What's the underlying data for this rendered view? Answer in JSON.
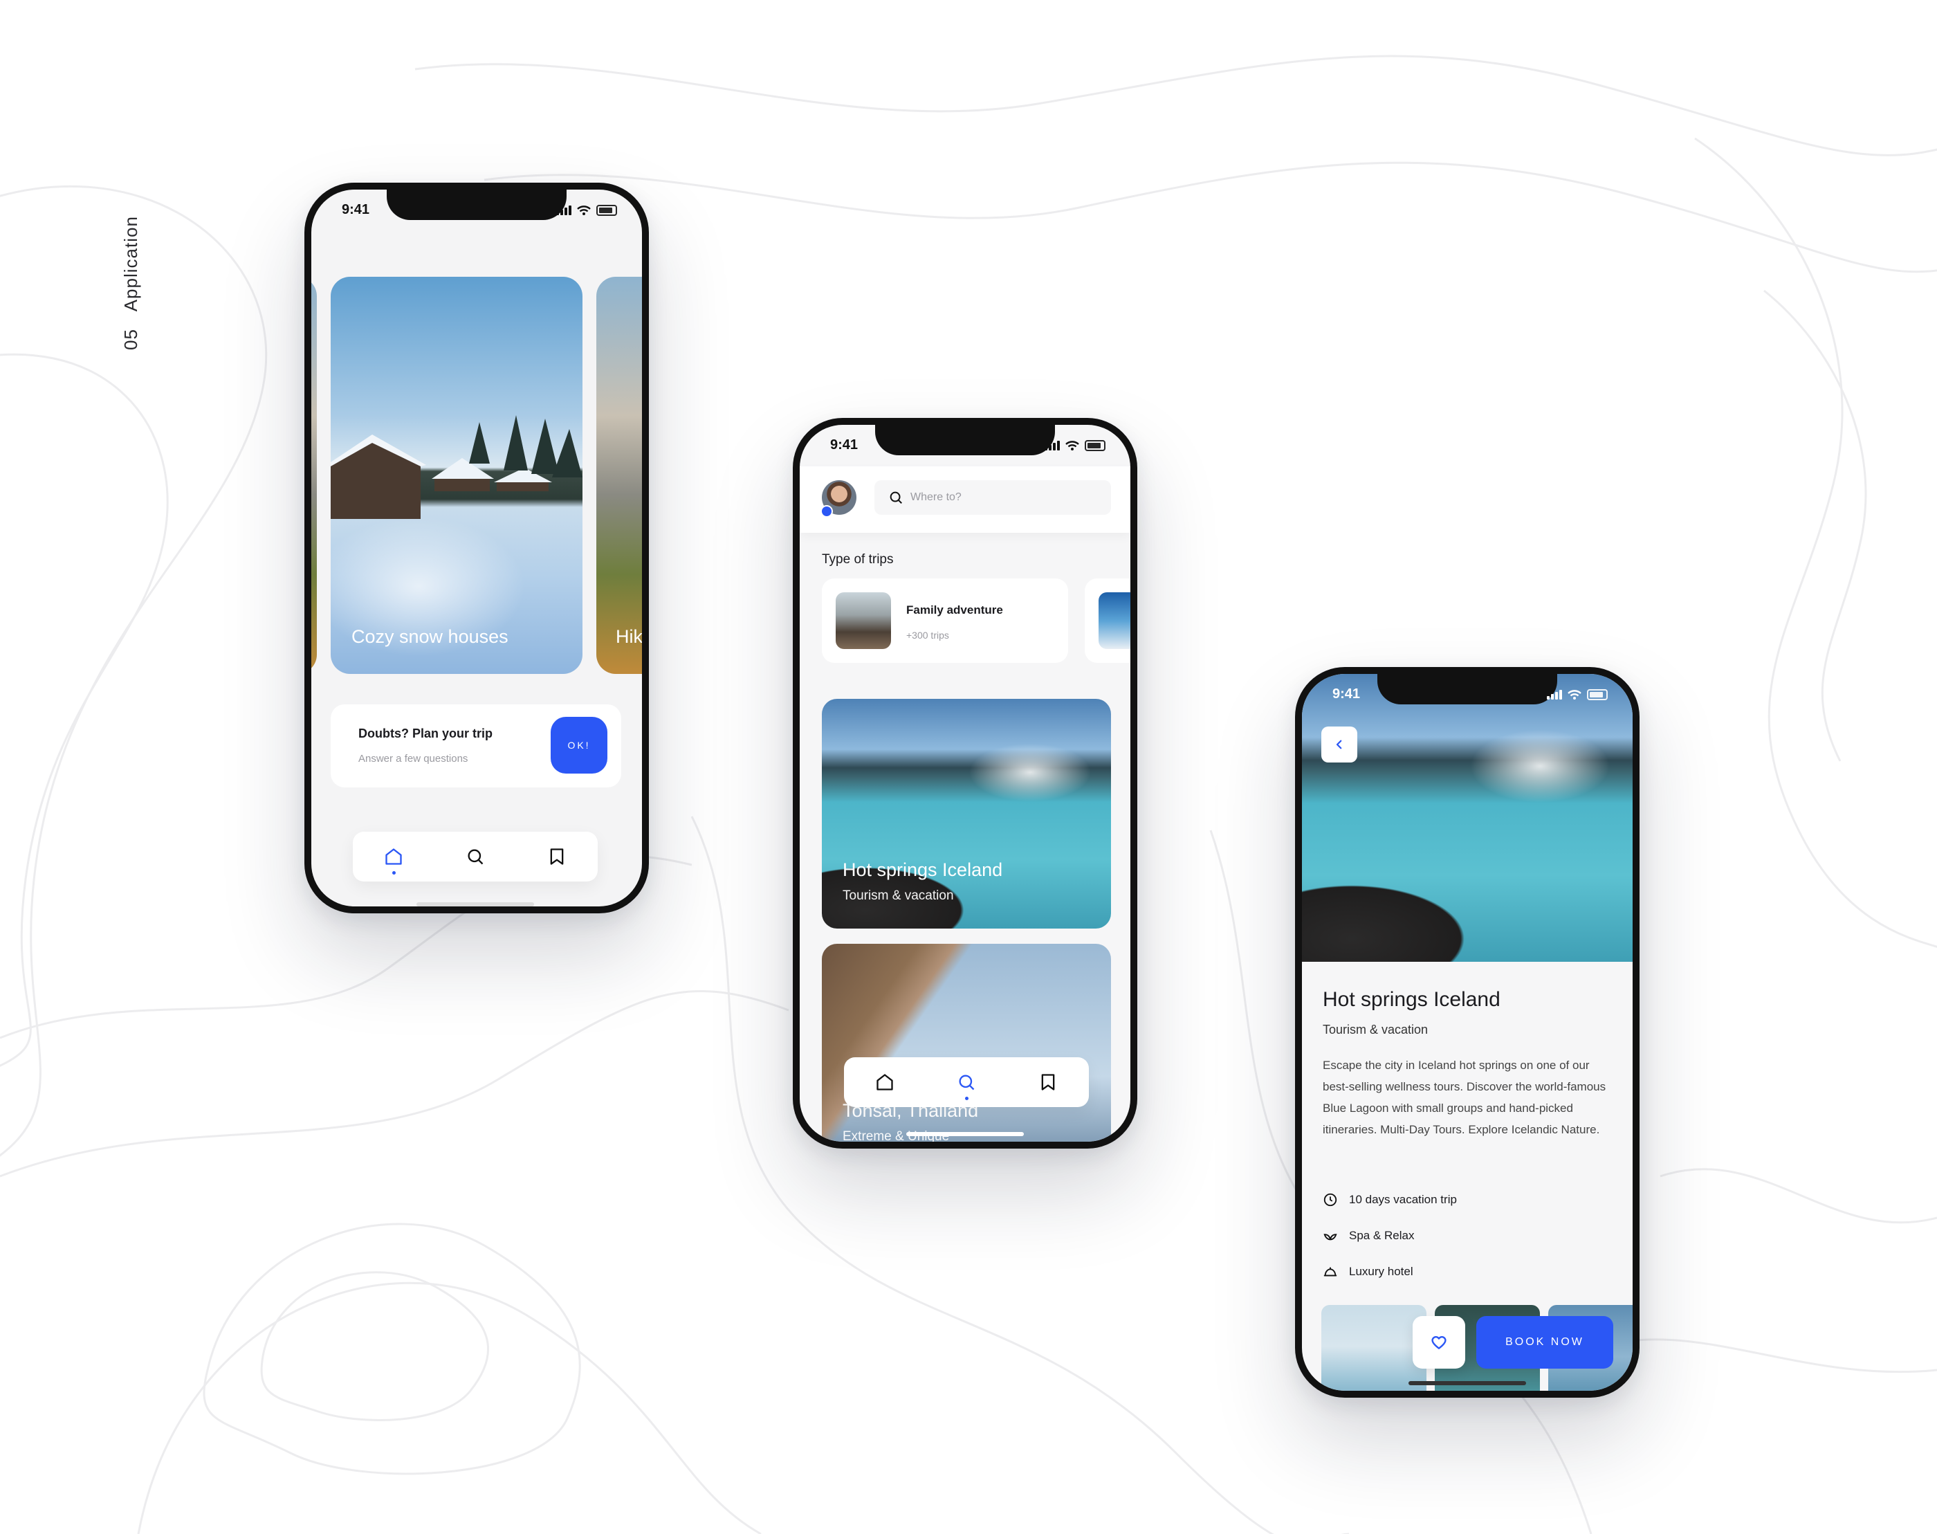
{
  "page": {
    "section_number": "05",
    "section_title": "Application"
  },
  "phone1": {
    "status_time": "9:41",
    "cards": [
      {
        "title": "Cozy snow houses"
      },
      {
        "title": "Hik"
      }
    ],
    "plan": {
      "title": "Doubts? Plan your trip",
      "subtitle": "Answer a few questions",
      "button": "OK!"
    }
  },
  "phone2": {
    "status_time": "9:41",
    "search_placeholder": "Where to?",
    "section_title": "Type of trips",
    "trip_type": {
      "title": "Family adventure",
      "count": "+300 trips"
    },
    "destinations": [
      {
        "title": "Hot springs Iceland",
        "subtitle": "Tourism & vacation"
      },
      {
        "title": "Tonsai, Thailand",
        "subtitle": "Extreme & Unique"
      }
    ]
  },
  "phone3": {
    "status_time": "9:41",
    "title": "Hot springs Iceland",
    "subtitle": "Tourism & vacation",
    "description": "Escape the city in Iceland hot springs on one of our best-selling wellness tours. Discover the world-famous Blue Lagoon with small groups and hand-picked itineraries. Multi-Day Tours. Explore Icelandic Nature.",
    "features": [
      {
        "icon": "clock-icon",
        "label": "10 days vacation trip"
      },
      {
        "icon": "spa-leaf-icon",
        "label": "Spa & Relax"
      },
      {
        "icon": "hotel-bell-icon",
        "label": "Luxury hotel"
      }
    ],
    "book_button": "BOOK NOW"
  },
  "colors": {
    "accent": "#2b57f5",
    "background": "#ffffff",
    "screen": "#f6f6f7"
  }
}
